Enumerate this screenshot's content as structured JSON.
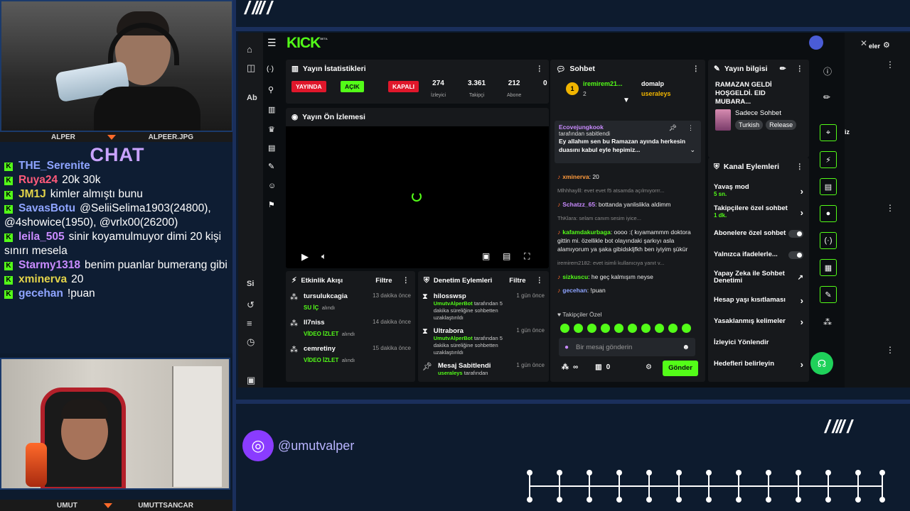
{
  "overlay": {
    "cam_top": {
      "left_label": "ALPER",
      "right_label": "ALPEER.JPG"
    },
    "cam_bottom": {
      "left_label": "UMUT",
      "right_label": "UMUTTSANCAR"
    },
    "chat_title": "CHAT",
    "chat_messages": [
      {
        "user": "THE_Serenite",
        "text": "",
        "color": "#8ea4ff"
      },
      {
        "user": "Ruya24",
        "text": "20k 30k",
        "color": "#ff5a7a"
      },
      {
        "user": "JM1J",
        "text": "kimler almıştı bunu",
        "color": "#e3d34a"
      },
      {
        "user": "SavasBotu",
        "text": "@SeliiSelima1903(24800), @4showice(1950), @vrlx00(26200)",
        "color": "#8ea4ff"
      },
      {
        "user": "leila_505",
        "text": "sinir koyamulmuyor dimi 20 kişi sınırı mesela",
        "color": "#c98bff"
      },
      {
        "user": "Starmy1318",
        "text": "benim puanlar bumerang gibi",
        "color": "#c98bff"
      },
      {
        "user": "xminerva",
        "text": "20",
        "color": "#e3d34a"
      },
      {
        "user": "gecehan",
        "text": "!puan",
        "color": "#8ea4ff"
      }
    ],
    "handle": "@umutvalper",
    "slashes_top": "/ /// /",
    "slashes_bottom": "/ /// /"
  },
  "kick": {
    "logo": "KICK",
    "logo_badge": "BETA",
    "stats": {
      "title": "Yayın İstatistikleri",
      "live_label": "YAYINDA",
      "open_label": "AÇIK",
      "closed_label": "KAPALI",
      "viewers": "274",
      "viewers_label": "İzleyici",
      "followers": "3.361",
      "followers_label": "Takipçi",
      "subs": "212",
      "subs_label": "Abone",
      "extra": "0"
    },
    "preview": {
      "title": "Yayın Ön İzlemesi"
    },
    "activity": {
      "title": "Etkinlik Akışı",
      "filter": "Filtre",
      "rows": [
        {
          "name": "tursulukcagia",
          "action": "SU İÇ",
          "suffix": "alındı",
          "time": "13 dakika önce"
        },
        {
          "name": "ll7niss",
          "action": "VİDEO İZLET",
          "suffix": "alındı",
          "time": "14 dakika önce"
        },
        {
          "name": "cemretiny",
          "action": "VİDEO İZLET",
          "suffix": "alındı",
          "time": "15 dakika önce"
        }
      ]
    },
    "moderation": {
      "title": "Denetim Eylemleri",
      "filter": "Filtre",
      "rows": [
        {
          "name": "hilosswsp",
          "by": "UmutvAlperBot",
          "text": "tarafından 5 dakika süreliğine sohbetten uzaklaştırıldı",
          "time": "1 gün önce"
        },
        {
          "name": "Ultrabora",
          "by": "UmutvAlperBot",
          "text": "tarafından 5 dakika süreliğine sohbetten uzaklaştırıldı",
          "time": "1 gün önce"
        },
        {
          "name": "Mesaj Sabitlendi",
          "by": "useraleys",
          "text": "tarafından",
          "time": "1 gün önce"
        }
      ]
    },
    "chat": {
      "title": "Sohbet",
      "top_user": "iremirem21...",
      "top_count": "2",
      "gifter1": "domalp",
      "gifter2": "useraleys",
      "pinned_user": "Ecovejungkook",
      "pinned_by": "tarafından sabitlendi",
      "pinned_text": "Ey allahım sen bu Ramazan ayında herkesin duasını kabul eyle hepimiz...",
      "lines": [
        {
          "user": "xminerva",
          "text": "20",
          "color": "#ff9a3c"
        },
        {
          "reply": "Mlhhhaylll: evet evet f5 atsamda açılmıyorrr..."
        },
        {
          "user": "Schatzz_65",
          "text": "bottanda yanlislikla aldimm",
          "color": "#c98bff"
        },
        {
          "reply": "ThKlara: selam canım sesim iyice..."
        },
        {
          "user": "kafamdakurbaga",
          "text": "oooo :( kıyamammm doktora gittin mi. özellikle bot olayındaki şarkıyı asla alamıyorum ya şaka gibidskljfkh ben iyiyim şükür",
          "color": "#53fc18"
        },
        {
          "reply": "iremirem2182: evet isimli kullanıcıya yanıt v..."
        },
        {
          "user": "sizkuscu",
          "text": "he geç kalmışım neyse",
          "color": "#53fc18"
        },
        {
          "user": "gecehan",
          "text": "!puan",
          "color": "#8ea4ff"
        }
      ],
      "followers_only": "Takipçiler Özel",
      "input_placeholder": "Bir mesaj gönderin",
      "infinity": "∞",
      "zero": "0",
      "send": "Gönder"
    },
    "stream_info": {
      "title": "Yayın bilgisi",
      "stream_title": "RAMAZAN GELDİ HOŞGELDİ. EID MUBARA...",
      "category": "Sadece Sohbet",
      "tags": [
        "Turkish",
        "Release"
      ]
    },
    "channel_actions": {
      "title": "Kanal Eylemleri",
      "items": [
        {
          "label": "Yavaş mod",
          "sub": "5 sn.",
          "ctrl": "arrow"
        },
        {
          "label": "Takipçilere özel sohbet",
          "sub": "1 dk.",
          "ctrl": "arrow"
        },
        {
          "label": "Abonelere özel sohbet",
          "sub": "",
          "ctrl": "toggle"
        },
        {
          "label": "Yalnızca ifadelerle...",
          "sub": "",
          "ctrl": "toggle"
        },
        {
          "label": "Yapay Zeka ile Sohbet Denetimi",
          "sub": "",
          "ctrl": "ext"
        },
        {
          "label": "Hesap yaşı kısıtlaması",
          "sub": "",
          "ctrl": "arrow"
        },
        {
          "label": "Yasaklanmış kelimeler",
          "sub": "",
          "ctrl": "arrow"
        },
        {
          "label": "İzleyici Yönlendir",
          "sub": "",
          "ctrl": "none"
        },
        {
          "label": "Hedefleri belirleyin",
          "sub": "",
          "ctrl": "arrow"
        }
      ]
    },
    "side_peek": {
      "text1": "eler",
      "text2": "iz",
      "sidebar_text": "Ab",
      "sidebar_text2": "Si"
    }
  }
}
